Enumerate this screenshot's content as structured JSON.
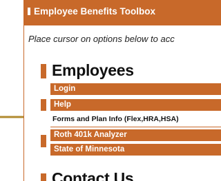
{
  "panel": {
    "title": "Employee Benefits Toolbox",
    "instructions": "Place cursor on options below to acc"
  },
  "employees": {
    "heading": "Employees",
    "items": [
      {
        "label": "Login"
      },
      {
        "label": "Help"
      },
      {
        "label": "Forms and Plan Info (Flex,HRA,HSA)",
        "selected": true
      },
      {
        "label": "Roth 401k Analyzer"
      },
      {
        "label": "State of Minnesota"
      }
    ]
  },
  "contact": {
    "heading": "Contact Us"
  },
  "colors": {
    "accent": "#c8692a",
    "pointer": "#b08a2e"
  },
  "icons": {
    "pointer": "arrow-right-icon"
  }
}
